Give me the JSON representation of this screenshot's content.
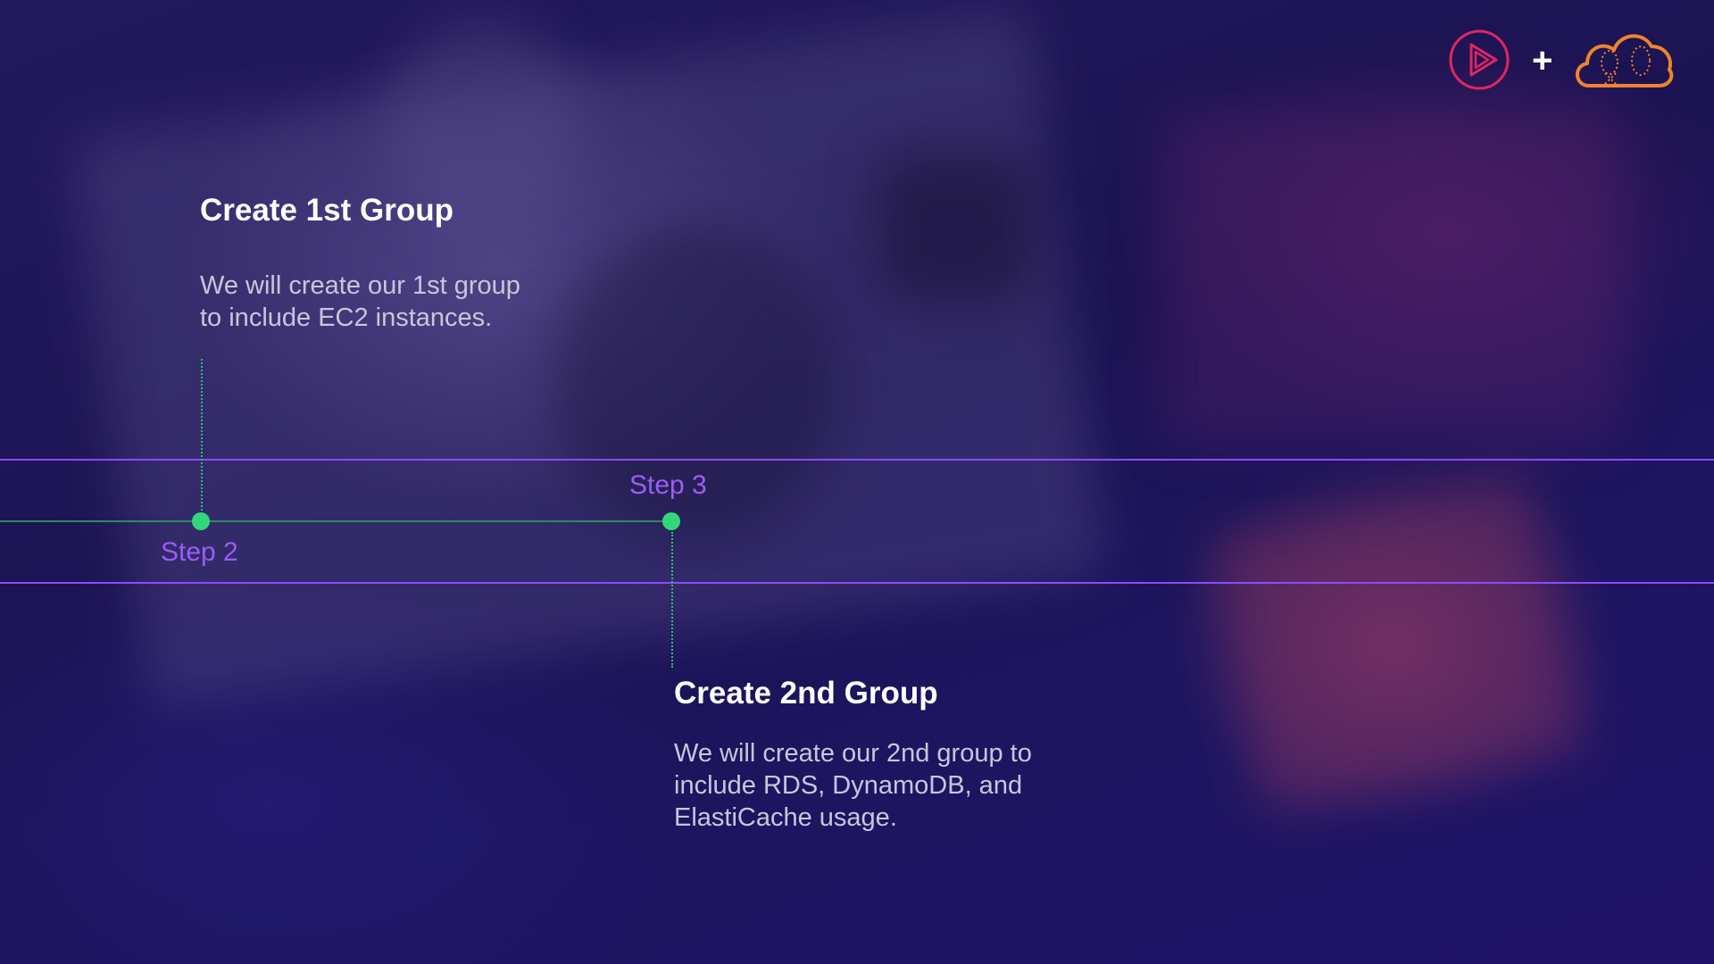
{
  "timeline": {
    "steps": [
      {
        "label": "Step 2"
      },
      {
        "label": "Step 3"
      }
    ],
    "cards": [
      {
        "title": "Create 1st Group",
        "description": "We will create our 1st group\nto include EC2 instances."
      },
      {
        "title": "Create 2nd Group",
        "description": "We will create our 2nd group to\ninclude RDS, DynamoDB, and\nElastiCache usage."
      }
    ]
  },
  "branding": {
    "play_logo_icon": "play-circle-logo-icon",
    "plus_symbol": "+",
    "cloud_logo_icon": "cloud-logo-icon",
    "accent_color": "#8a4bff",
    "step_color": "#9b5cf6",
    "node_color": "#2fd97a",
    "play_logo_color": "#e0265f",
    "cloud_logo_color": "#f0832a"
  }
}
